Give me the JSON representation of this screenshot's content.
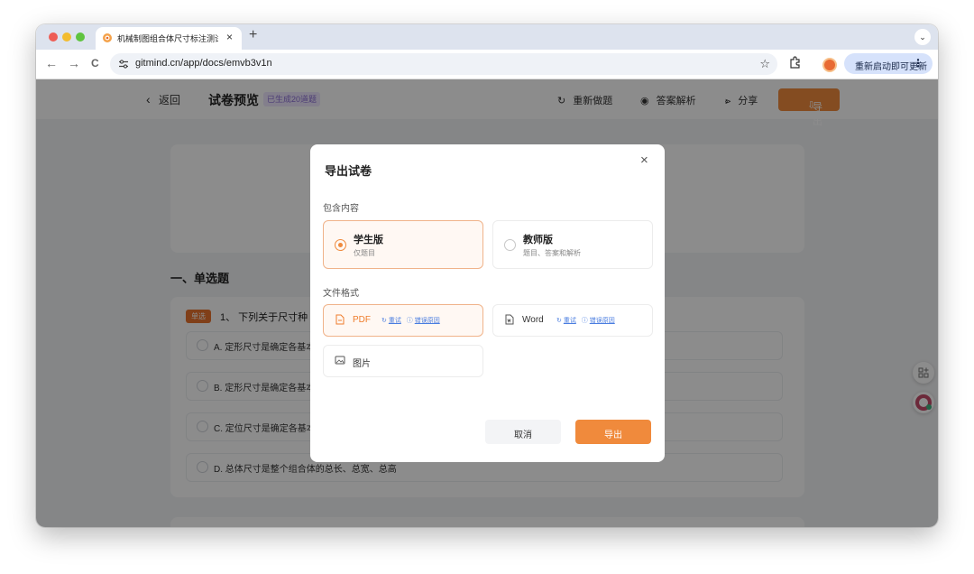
{
  "browser": {
    "tab_title": "机械制图组合体尺寸标注测试 -",
    "tab_close": "×",
    "new_tab": "+",
    "url": "gitmind.cn/app/docs/emvb3v1n",
    "update_button": "重新启动即可更新",
    "menu": "⋮",
    "nav_back": "←",
    "nav_forward": "→",
    "nav_reload": "C",
    "star": "☆",
    "tab_menu": "⌄"
  },
  "page": {
    "back_label": "返回",
    "title": "试卷预览",
    "badge": "已生成20道题",
    "toolbar": {
      "redo": "重新做题",
      "answers": "答案解析",
      "share": "分享",
      "export": "导出"
    },
    "section_title": "一、单选题",
    "question": {
      "type_badge": "单选",
      "text": "1、 下列关于尺寸种",
      "options": [
        "A. 定形尺寸是确定各基本",
        "B. 定形尺寸是确定各基本",
        "C. 定位尺寸是确定各基本",
        "D. 总体尺寸是整个组合体的总长、总宽、总高"
      ]
    }
  },
  "modal": {
    "title": "导出试卷",
    "close": "×",
    "content_label": "包含内容",
    "versions": [
      {
        "name": "学生版",
        "desc": "仅题目",
        "selected": true
      },
      {
        "name": "教师版",
        "desc": "题目、答案和解析",
        "selected": false
      }
    ],
    "format_label": "文件格式",
    "formats": [
      {
        "name": "PDF",
        "retry": "重试",
        "error": "错误原因",
        "selected": true
      },
      {
        "name": "Word",
        "retry": "重试",
        "error": "错误原因",
        "selected": false
      },
      {
        "name": "图片",
        "selected": false
      }
    ],
    "cancel": "取消",
    "export": "导出"
  },
  "colors": {
    "accent": "#F08A3C",
    "link": "#4A7DE0",
    "badge": "#E9742E"
  }
}
